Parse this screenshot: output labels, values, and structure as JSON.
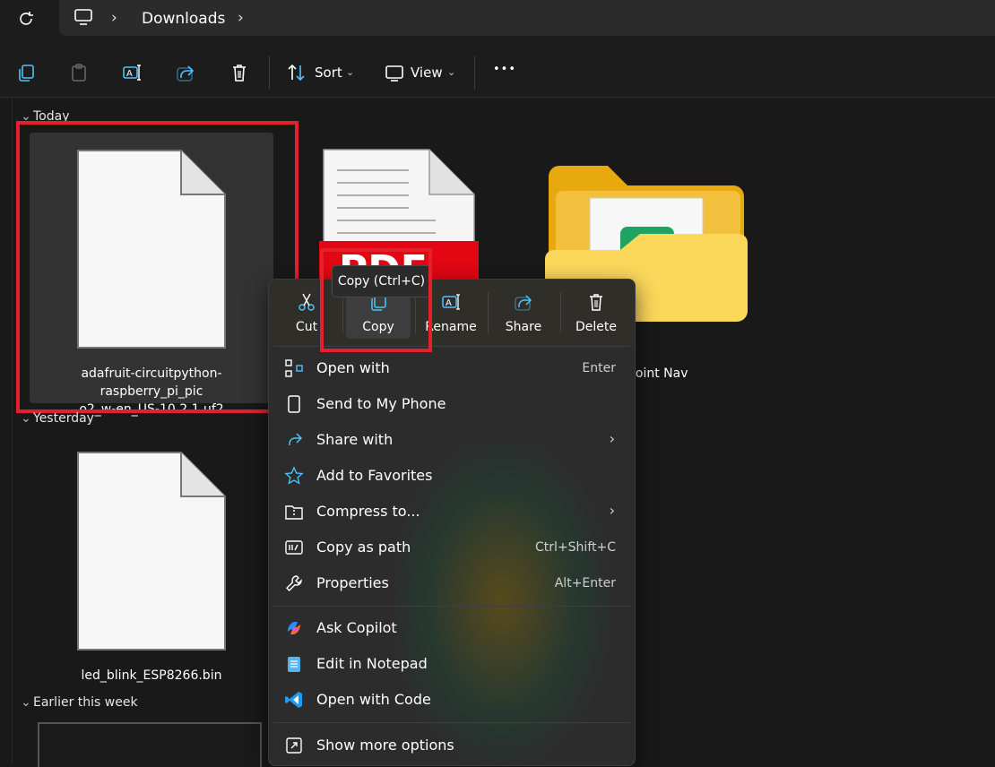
{
  "address_bar": {
    "crumb": "Downloads",
    "sep": "›"
  },
  "toolbar": {
    "sort_label": "Sort",
    "view_label": "View",
    "more_label": "•••"
  },
  "groups": {
    "today": "Today",
    "yesterday": "Yesterday",
    "earlier": "Earlier this week"
  },
  "files": {
    "uf2_name_line1": "adafruit-circuitpython-raspberry_pi_pic",
    "uf2_name_line2": "o2_w-en_US-10.2.1.uf2",
    "pdf_badge": "PDF",
    "folder_name": "point Nav",
    "bin_name": "led_blink_ESP8266.bin"
  },
  "tooltip": "Copy (Ctrl+C)",
  "context_menu": {
    "quick_actions": [
      "Cut",
      "Copy",
      "Rename",
      "Share",
      "Delete"
    ],
    "items": [
      {
        "label": "Open with",
        "shortcut": "Enter"
      },
      {
        "label": "Send to My Phone",
        "shortcut": ""
      },
      {
        "label": "Share with",
        "shortcut": "›"
      },
      {
        "label": "Add to Favorites",
        "shortcut": ""
      },
      {
        "label": "Compress to...",
        "shortcut": "›"
      },
      {
        "label": "Copy as path",
        "shortcut": "Ctrl+Shift+C"
      },
      {
        "label": "Properties",
        "shortcut": "Alt+Enter"
      },
      {
        "label": "Ask Copilot",
        "shortcut": ""
      },
      {
        "label": "Edit in Notepad",
        "shortcut": ""
      },
      {
        "label": "Open with Code",
        "shortcut": ""
      },
      {
        "label": "Show more options",
        "shortcut": ""
      }
    ]
  },
  "colors": {
    "highlight_red": "#e4212a",
    "accent_blue": "#4cc2ff",
    "pdf_red": "#e30613",
    "folder_yellow": "#f6c343"
  }
}
